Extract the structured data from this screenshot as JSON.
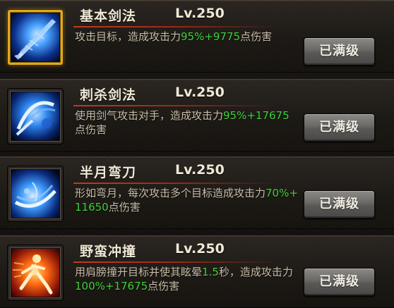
{
  "skills": [
    {
      "name": "基本剑法",
      "level": "Lv.250",
      "desc_a": "攻击目标，造成攻击力",
      "desc_b": "95%+9775",
      "desc_c": "点伤害",
      "desc_d": "",
      "desc_e": "",
      "icon": "sword-slash-icon",
      "button": "已满级",
      "selected": true
    },
    {
      "name": "刺杀剑法",
      "level": "Lv.250",
      "desc_a": "使用剑气攻击对手，造成攻击力",
      "desc_b": "95%+17675",
      "desc_c": "点伤害",
      "desc_d": "",
      "desc_e": "",
      "icon": "sword-arc-icon",
      "button": "已满级",
      "selected": false
    },
    {
      "name": "半月弯刀",
      "level": "Lv.250",
      "desc_a": "形如弯月，每次攻击多个目标造成攻击力",
      "desc_b": "70%+11650",
      "desc_c": "点伤害",
      "desc_d": "",
      "desc_e": "",
      "icon": "crescent-wave-icon",
      "button": "已满级",
      "selected": false
    },
    {
      "name": "野蛮冲撞",
      "level": "Lv.250",
      "desc_a": "用肩膀撞开目标并使其眩晕",
      "desc_b": "1.5",
      "desc_c": "秒，造成攻击力",
      "desc_d": "100%+17675",
      "desc_e": "点伤害",
      "icon": "charging-warrior-icon",
      "button": "已满级",
      "selected": false
    }
  ],
  "colors": {
    "highlight": "#3fd23a",
    "selected_frame": "#e1a81a",
    "text": "#c9bea8",
    "title": "#f1e8d6"
  }
}
